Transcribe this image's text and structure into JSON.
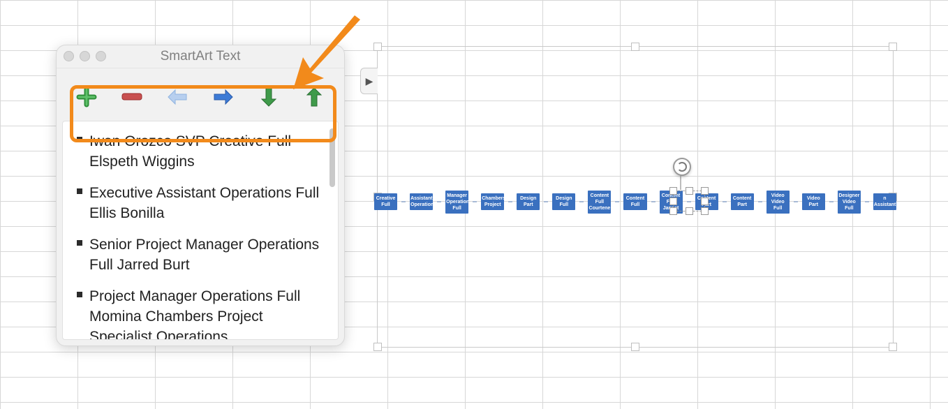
{
  "panel": {
    "title": "SmartArt Text",
    "toolbar": {
      "add": "add-shape",
      "remove": "remove-shape",
      "left": "demote-left",
      "right": "promote-right",
      "down": "move-down",
      "up": "move-up"
    },
    "items": [
      "Iwan Orozco  SVP Creative Full Elspeth Wiggins",
      "Executive Assistant Operations Full Ellis Bonilla",
      "Senior Project Manager Operations Full Jarred Burt",
      "Project Manager Operations Full Momina Chambers Project Specialist  Operations"
    ]
  },
  "canvas": {
    "expand_glyph": "▶",
    "nodes": [
      "Creative Full",
      "Assistant Operations",
      "Manager Operations Full",
      "Chambers Project",
      "Design Part",
      "Design Full",
      "Content Full Courtene",
      "Content Full",
      "Content Full Jannet",
      "Content Part",
      "Content Part",
      "Video Video Full",
      "Video Part",
      "Designer Video Full",
      "n Assistant"
    ],
    "selected_index": 9
  },
  "annotation": {
    "arrow_color": "#f28a1b"
  }
}
